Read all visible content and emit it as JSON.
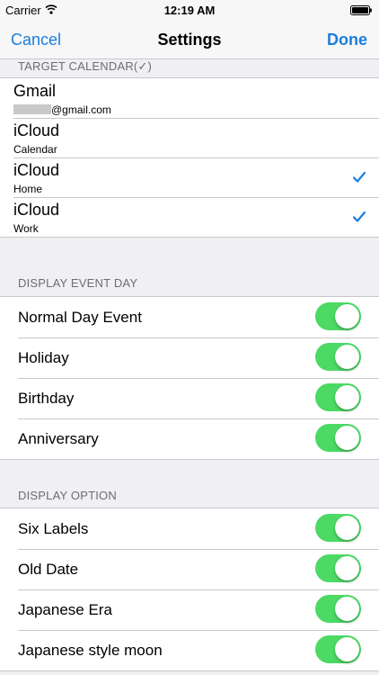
{
  "status_bar": {
    "carrier": "Carrier",
    "time": "12:19 AM",
    "wifi_icon": "wifi-icon",
    "battery_icon": "battery-icon"
  },
  "nav": {
    "left": "Cancel",
    "title": "Settings",
    "right": "Done"
  },
  "colors": {
    "accent": "#1a7ddf",
    "switch_on": "#4cd964",
    "background": "#efeff4",
    "header_text": "#6d6d72"
  },
  "target_calendar": {
    "header": "TARGET CALENDAR(✓)",
    "items": [
      {
        "title": "Gmail",
        "subtitle": "@gmail.com",
        "masked_prefix": true,
        "checked": false
      },
      {
        "title": "iCloud",
        "subtitle": "Calendar",
        "checked": false
      },
      {
        "title": "iCloud",
        "subtitle": "Home",
        "checked": true
      },
      {
        "title": "iCloud",
        "subtitle": "Work",
        "checked": true
      }
    ]
  },
  "display_event_day": {
    "header": "DISPLAY EVENT DAY",
    "items": [
      {
        "label": "Normal Day Event",
        "on": true
      },
      {
        "label": "Holiday",
        "on": true
      },
      {
        "label": "Birthday",
        "on": true
      },
      {
        "label": "Anniversary",
        "on": true
      }
    ]
  },
  "display_option": {
    "header": "DISPLAY OPTION",
    "items": [
      {
        "label": "Six Labels",
        "on": true
      },
      {
        "label": "Old Date",
        "on": true
      },
      {
        "label": "Japanese Era",
        "on": true
      },
      {
        "label": "Japanese style moon",
        "on": true
      }
    ]
  }
}
